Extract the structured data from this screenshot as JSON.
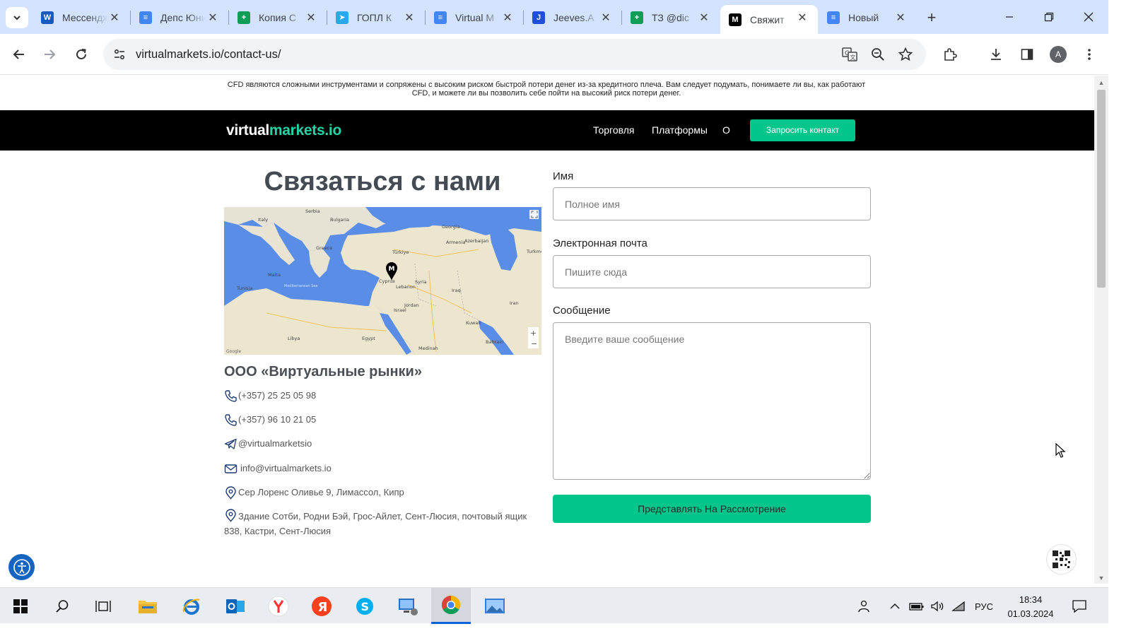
{
  "browser": {
    "tabs": [
      {
        "title": "Мессенджер",
        "icon": "word-icon",
        "color": "#185abd"
      },
      {
        "title": "Депс Юнит",
        "icon": "google-docs-icon",
        "color": "#4285f4"
      },
      {
        "title": "Копия С",
        "icon": "google-sheets-icon",
        "color": "#0f9d58"
      },
      {
        "title": "ГОПЛ К",
        "icon": "telegram-icon",
        "color": "#29a9eb"
      },
      {
        "title": "Virtual M",
        "icon": "google-docs-icon",
        "color": "#4285f4"
      },
      {
        "title": "Jeeves.A",
        "icon": "jeeves-icon",
        "color": "#1f4fd8"
      },
      {
        "title": "ТЗ @dic",
        "icon": "google-sheets-icon",
        "color": "#0f9d58"
      },
      {
        "title": "Свяжит",
        "icon": "virtualmarkets-icon",
        "color": "#000000",
        "active": true
      },
      {
        "title": "Новый",
        "icon": "google-docs-icon",
        "color": "#4285f4"
      }
    ],
    "url": "virtualmarkets.io/contact-us/",
    "profile_initial": "A"
  },
  "site": {
    "risk_warning": "CFD являются сложными инструментами и сопряжены с высоким риском быстрой потери денег из-за кредитного плеча. Вам следует подумать, понимаете ли вы, как работают CFD, и можете ли вы позволить себе пойти на высокий риск потери денег.",
    "logo_part1": "virtual",
    "logo_part2": "markets.io",
    "nav": {
      "trading": "Торговля",
      "platforms": "Платформы",
      "about": "О"
    },
    "cta_label": "Запросить контакт",
    "brand_color": "#00c68b"
  },
  "contact": {
    "title": "Связаться с нами",
    "company": "ООО «Виртуальные рынки»",
    "phone1": "(+357) 25 25 05 98",
    "phone2": "(+357) 96 10 21 05",
    "telegram": "@virtualmarketsio",
    "email": "info@virtualmarkets.io",
    "address1": "Сер Лоренс Оливье 9, Лимассол, Кипр",
    "address2": "Здание Сотби, Родни Бэй, Грос-Айлет, Сент-Люсия, почтовый ящик 838, Кастри, Сент-Люсия"
  },
  "map": {
    "marker": "M",
    "labels": [
      "Serbia",
      "Bulgaria",
      "Georgia",
      "Italy",
      "Armenia",
      "Azerbaijan",
      "Greece",
      "Türkiye",
      "Turkme",
      "Malta",
      "Tunisia",
      "Cyprus",
      "Syria",
      "Lebanon",
      "Iraq",
      "Iran",
      "Israel",
      "Jordan",
      "Kuwait",
      "Libya",
      "Egypt",
      "Bahrain",
      "Mediterranean Sea",
      "Medinah",
      "Google"
    ]
  },
  "form": {
    "name_label": "Имя",
    "name_placeholder": "Полное имя",
    "email_label": "Электронная почта",
    "email_placeholder": "Пишите сюда",
    "message_label": "Сообщение",
    "message_placeholder": "Введите ваше сообщение",
    "submit_label": "Представлять На Рассмотрение"
  },
  "taskbar": {
    "language": "РУС",
    "time": "18:34",
    "date": "01.03.2024"
  }
}
